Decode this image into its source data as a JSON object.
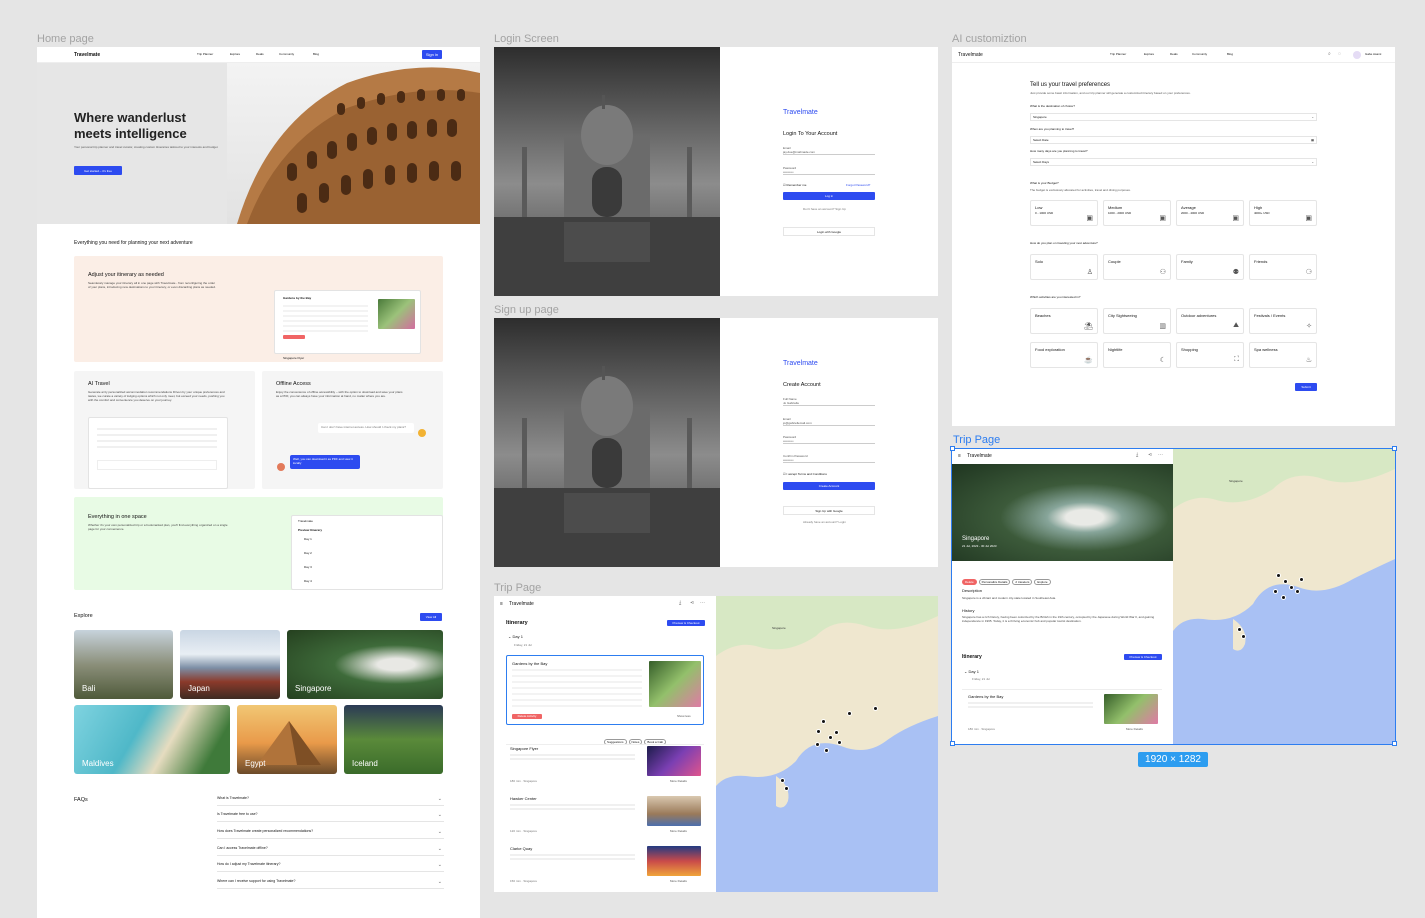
{
  "labels": {
    "home": "Home page",
    "login": "Login Screen",
    "signup": "Sign up page",
    "trip": "Trip Page",
    "ai": "AI customiztion",
    "trip2": "Trip Page",
    "dims": "1920 × 1282"
  },
  "brand": "Travelmate",
  "nav": [
    "Trip Planner",
    "Explore",
    "Deals",
    "Community",
    "Blog"
  ],
  "home": {
    "signin": "Sign in",
    "hero_title_1": "Where wanderlust",
    "hero_title_2": "meets intelligence",
    "hero_sub": "Your personal trip planner and travel curator, creating custom itineraries tailored to your interests and budget",
    "hero_cta": "Get started – it's free",
    "everything": "Everything you need for planning your next adventure",
    "f1_title": "Adjust your itinerary as needed",
    "f1_text": "Seamlessly manage your itinerary all in one page with Travelmate - from reconfiguring the order of your plans, introducing new destinations to your itinerary, or even discarding plans as needed.",
    "f1_card_title": "Gardens by the Bay",
    "f1_card_next": "Singapore Flyer",
    "f2_title": "AI Travel",
    "f2_text": "Generate ai tly personalized accommodation recommendations Driven by your unique preferences and tastes, we curate a variety of lodging options which not only meet, but exceed your needs, pushing you with the comfort and convenience you deserve on your journey.",
    "f3_title": "Offline Access",
    "f3_text": "Enjoy the convenience of offline accessibility – with the option to download and save your plans as a PDF, you can always have your information at hand, no matter where you are.",
    "f3_q": "Can I don't have internet access. How should I check my plans?",
    "f3_a": "Well, you can download it as PDF and view it locally",
    "f4_title": "Everything in one space",
    "f4_text": "Whether it's your own personalized trip or a bookmarked plan, you'll find everything organized on a single page for your convenience.",
    "f4_card_title": "Preview Itinerary",
    "f4_days": [
      "Day 1",
      "Day 2",
      "Day 3",
      "Day 4"
    ],
    "explore": "Explore",
    "view_all": "View All",
    "destinations": [
      "Bali",
      "Japan",
      "Singapore",
      "Maldives",
      "Egypt",
      "Iceland"
    ],
    "faqs_title": "FAQs",
    "faqs": [
      "What is Travelmate?",
      "Is Travelmate free to use?",
      "How does Travelmate create personalized recommendations?",
      "Can I access Travelmate offline?",
      "How do I adjust my Travelmate itinerary?",
      "Where can I receive support for using Travelmate?"
    ]
  },
  "login": {
    "title": "Login To Your Account",
    "email_label": "Email",
    "email_value": "jay.doe@mailmade.com",
    "password_label": "Password",
    "password_value": "••••••••••",
    "remember": "Remember me",
    "forgot": "Forgot Password?",
    "login_btn": "Log in",
    "no_account": "Don't have an account? Sign Up",
    "google": "Login with Google"
  },
  "signup": {
    "title": "Create Account",
    "fullname_label": "Full Name",
    "fullname_value": "Jo Gabrielle",
    "email_label": "Email",
    "email_value": "jo@gabriellemail.com",
    "password_label": "Password",
    "password_value": "••••••••••",
    "confirm_label": "Confirm Password",
    "confirm_value": "••••••••••",
    "terms": "I accept Terms and Conditions",
    "create_btn": "Create Account",
    "google": "Sign Up with Google",
    "have_account": "Already have an account? Login"
  },
  "trip": {
    "itinerary": "Itinerary",
    "preview_btn": "Preview & Checkout",
    "day1": "Day 1",
    "day1_date": "Friday, 21 Jul",
    "item1_title": "Gardens by the Bay",
    "item1_tags": [
      "Suggestions",
      "Notes",
      "Book a Cab"
    ],
    "delete": "Delete Activity",
    "show_less": "Show less",
    "more_details": "More Details",
    "items": [
      {
        "title": "Singapore Flyer",
        "loc": "180 min · Singapore"
      },
      {
        "title": "Hawker Center",
        "loc": "120 min · Singapore"
      },
      {
        "title": "Clarke Quay",
        "loc": "150 min · Singapore"
      }
    ],
    "map_city": "Singapore"
  },
  "ai": {
    "title": "Tell us your travel preferences",
    "sub": "Just provide some basic information, and our trip planner will generate a customized itinerary based on your preferences.",
    "q_dest": "What is the destination of choice?",
    "dest_value": "Singapore",
    "q_when": "When are you planning to travel?",
    "when_value": "Select Date",
    "q_days": "How many days are you planning to travel?",
    "days_value": "Select Days",
    "q_budget": "What is your Budget?",
    "budget_sub": "The budget is exclusively allocated for activities, travel and dining purposes.",
    "budgets": [
      {
        "name": "Low",
        "range": "0 - 1000 USD"
      },
      {
        "name": "Medium",
        "range": "1000 - 2000 USD"
      },
      {
        "name": "Average",
        "range": "2000 - 4000 USD"
      },
      {
        "name": "High",
        "range": "4000+ USD"
      }
    ],
    "q_who": "How do you plan on traveling your next adventure?",
    "who": [
      "Solo",
      "Couple",
      "Family",
      "Friends"
    ],
    "q_act": "Which activities are you interested in?",
    "activities": [
      "Beaches",
      "City Sightseeing",
      "Outdoor adventures",
      "Festivals / Events",
      "Food exploration",
      "Nightlife",
      "Shopping",
      "Spa wellness"
    ],
    "submit": "Submit",
    "user": "Gabe Asami"
  },
  "trip2": {
    "city": "Singapore",
    "dates": "21 Jul, 2023 - 30 Jul 2023",
    "tags": [
      "Delete",
      "Personalize Details",
      "2 travelers",
      "Explore"
    ],
    "desc": "Description",
    "desc_text": "Singapore is a vibrant and modern city-state located in Southeast Asia.",
    "history": "History",
    "history_text": "Singapore has a rich history, having been colonized by the British in the 19th century, occupied by the Japanese during World War II, and gaining independence in 1965. Today, it is a thriving economic hub and popular tourist destination.",
    "itinerary": "Itinerary",
    "preview_btn": "Preview & Checkout",
    "day1": "Day 1",
    "day1_date": "Friday, 21 Jul",
    "item": "Gardens by the Bay",
    "item_loc": "180 min · Singapore",
    "more": "More Details"
  }
}
